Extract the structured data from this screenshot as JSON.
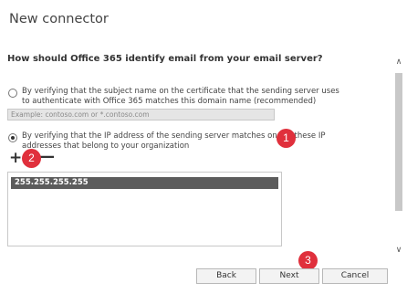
{
  "dialog": {
    "title": "New connector"
  },
  "question": "How should Office 365 identify email from your email server?",
  "option_certificate": {
    "line1": "By verifying that the subject name on the certificate that the sending server uses",
    "line2": "to authenticate with Office 365 matches this domain name (recommended)",
    "selected": false
  },
  "domain_input": {
    "placeholder": "Example: contoso.com or *.contoso.com",
    "value": ""
  },
  "option_ip": {
    "line1": "By verifying that the IP address of the sending server matches one of these IP",
    "line2": "addresses that belong to your organization",
    "selected": true
  },
  "toolbar": {
    "add_icon": "+",
    "remove_icon": "—"
  },
  "ip_list": {
    "items": [
      "255.255.255.255"
    ]
  },
  "badges": [
    "1",
    "2",
    "3"
  ],
  "scroll": {
    "up_icon": "∧",
    "down_icon": "∨"
  },
  "buttons": {
    "back": "Back",
    "next": "Next",
    "cancel": "Cancel"
  },
  "colors": {
    "badge": "#e0303c",
    "selected_row": "#5c5c5c"
  }
}
